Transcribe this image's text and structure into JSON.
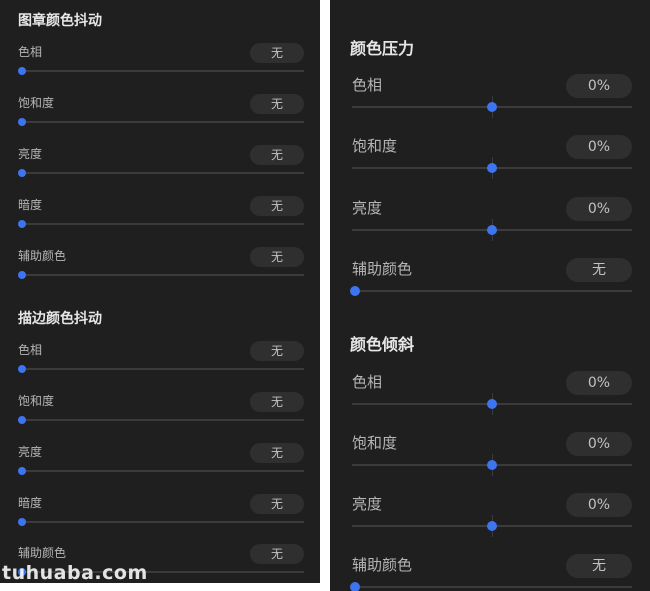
{
  "left_panel": {
    "sections": [
      {
        "title": "图章颜色抖动",
        "rows": [
          {
            "label": "色相",
            "value": "无",
            "level": 0
          },
          {
            "label": "饱和度",
            "value": "无",
            "level": 0
          },
          {
            "label": "亮度",
            "value": "无",
            "level": 0
          },
          {
            "label": "暗度",
            "value": "无",
            "level": 0
          },
          {
            "label": "辅助颜色",
            "value": "无",
            "level": 0
          }
        ]
      },
      {
        "title": "描边颜色抖动",
        "rows": [
          {
            "label": "色相",
            "value": "无",
            "level": 0
          },
          {
            "label": "饱和度",
            "value": "无",
            "level": 0
          },
          {
            "label": "亮度",
            "value": "无",
            "level": 0
          },
          {
            "label": "暗度",
            "value": "无",
            "level": 0
          },
          {
            "label": "辅助颜色",
            "value": "无",
            "level": 0
          }
        ]
      }
    ]
  },
  "right_panel": {
    "sections": [
      {
        "title": "颜色压力",
        "rows": [
          {
            "label": "色相",
            "value": "0%",
            "level": 0.5
          },
          {
            "label": "饱和度",
            "value": "0%",
            "level": 0.5
          },
          {
            "label": "亮度",
            "value": "0%",
            "level": 0.5
          },
          {
            "label": "辅助颜色",
            "value": "无",
            "level": 0
          }
        ]
      },
      {
        "title": "颜色倾斜",
        "rows": [
          {
            "label": "色相",
            "value": "0%",
            "level": 0.5
          },
          {
            "label": "饱和度",
            "value": "0%",
            "level": 0.5
          },
          {
            "label": "亮度",
            "value": "0%",
            "level": 0.5
          },
          {
            "label": "辅助颜色",
            "value": "无",
            "level": 0
          }
        ]
      }
    ]
  },
  "watermark": "tuhuaba.com",
  "colors": {
    "panel_bg": "#1f1f1f",
    "slider_accent": "#3d74f0",
    "track": "#3b3b3b",
    "value_pill": "#2f2f2f"
  }
}
